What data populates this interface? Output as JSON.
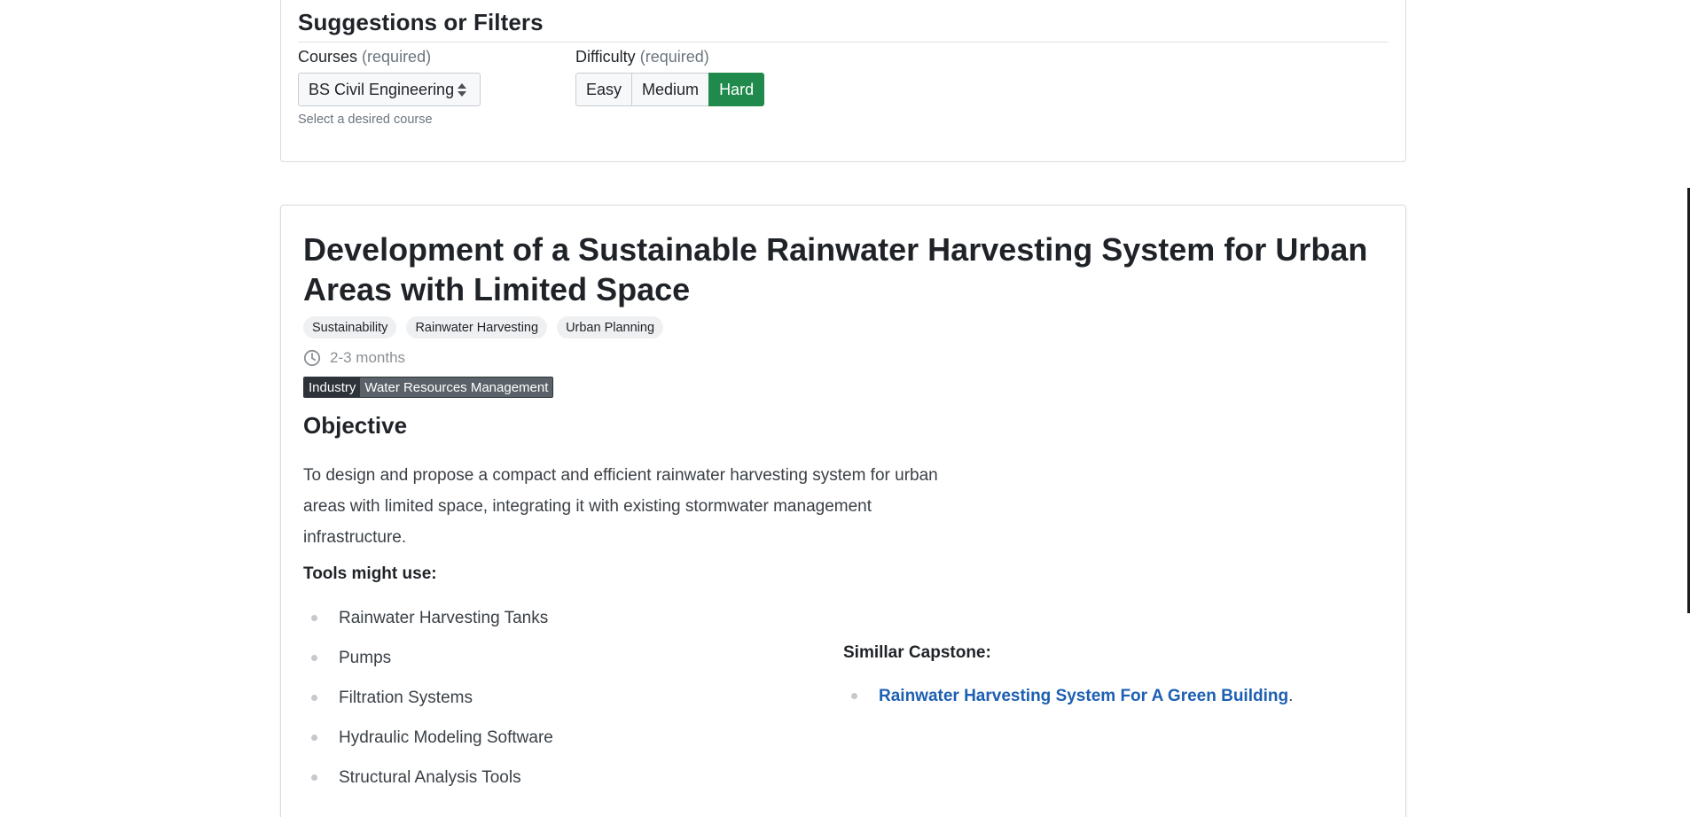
{
  "filters": {
    "title": "Suggestions or Filters",
    "courses": {
      "label": "Courses",
      "required_note": "(required)",
      "selected": "BS Civil Engineering",
      "help_text": "Select a desired course"
    },
    "difficulty": {
      "label": "Difficulty",
      "required_note": "(required)",
      "options": [
        "Easy",
        "Medium",
        "Hard"
      ],
      "selected": "Hard"
    }
  },
  "project": {
    "title": "Development of a Sustainable Rainwater Harvesting System for Urban Areas with Limited Space",
    "tags": [
      "Sustainability",
      "Rainwater Harvesting",
      "Urban Planning"
    ],
    "duration": "2-3 months",
    "industry": {
      "key": "Industry",
      "value": "Water Resources Management"
    },
    "objective_heading": "Objective",
    "objective_text": "To design and propose a compact and efficient rainwater harvesting system for urban areas with limited space, integrating it with existing stormwater management infrastructure.",
    "tools_heading": "Tools might use:",
    "tools": [
      "Rainwater Harvesting Tanks",
      "Pumps",
      "Filtration Systems",
      "Hydraulic Modeling Software",
      "Structural Analysis Tools"
    ],
    "similar_heading": "Simillar Capstone:",
    "similar": [
      {
        "label": "Rainwater Harvesting System For A Green Building",
        "suffix": "."
      }
    ]
  },
  "colors": {
    "accent_green": "#1f8a4c",
    "link_blue": "#1d5fb2",
    "muted": "#6c757d"
  },
  "icons": {
    "duration": "clock-icon",
    "select": "sort-arrows-icon",
    "list_bullet": "bullet-dot-icon"
  }
}
